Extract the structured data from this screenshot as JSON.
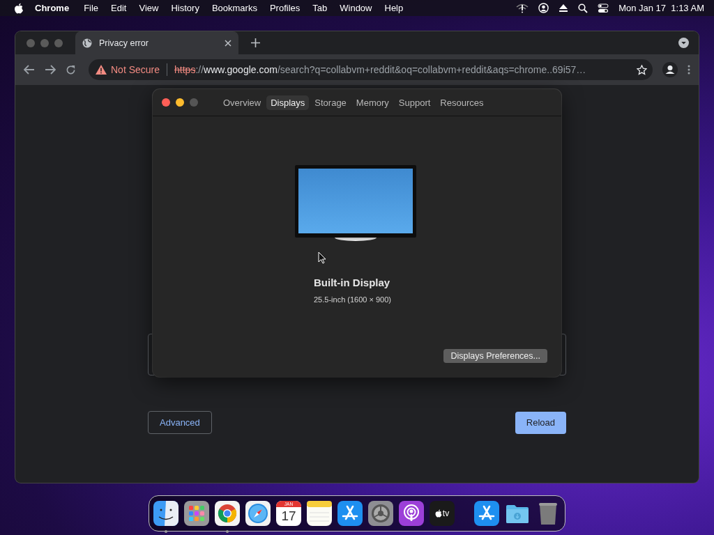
{
  "menu_bar": {
    "app_name": "Chrome",
    "items": [
      "File",
      "Edit",
      "View",
      "History",
      "Bookmarks",
      "Profiles",
      "Tab",
      "Window",
      "Help"
    ],
    "clock": "Mon Jan 17  1:13 AM"
  },
  "browser": {
    "tab": {
      "title": "Privacy error"
    },
    "address_bar": {
      "security_label": "Not Secure",
      "scheme": "https",
      "separator": "://",
      "host": "www.google.com",
      "path": "/search?q=collabvm+reddit&oq=collabvm+reddit&aqs=chrome..69i57…"
    },
    "page": {
      "buttons": [
        {
          "label": "Advanced",
          "kind": "secondary"
        },
        {
          "label": "Reload",
          "kind": "primary"
        }
      ]
    }
  },
  "about_window": {
    "tabs": [
      {
        "label": "Overview",
        "selected": false
      },
      {
        "label": "Displays",
        "selected": true
      },
      {
        "label": "Storage",
        "selected": false
      },
      {
        "label": "Memory",
        "selected": false
      },
      {
        "label": "Support",
        "selected": false
      },
      {
        "label": "Resources",
        "selected": false
      }
    ],
    "display_name": "Built-in Display",
    "display_spec": "25.5-inch (1600 × 900)",
    "button": "Displays Preferences..."
  },
  "dock": [
    {
      "kind": "finder",
      "running": true
    },
    {
      "kind": "launchpad",
      "running": false
    },
    {
      "kind": "chrome",
      "running": true
    },
    {
      "kind": "safari",
      "running": false
    },
    {
      "kind": "calendar",
      "running": false,
      "month": "JAN",
      "day": "17"
    },
    {
      "kind": "notes",
      "running": false
    },
    {
      "kind": "appstore",
      "running": false
    },
    {
      "kind": "settings",
      "running": false
    },
    {
      "kind": "podcasts",
      "running": false
    },
    {
      "kind": "tv",
      "running": false,
      "label": "tv"
    },
    {
      "kind": "separator"
    },
    {
      "kind": "appstore",
      "running": false
    },
    {
      "kind": "folder",
      "running": false
    },
    {
      "kind": "trash",
      "running": false
    }
  ]
}
